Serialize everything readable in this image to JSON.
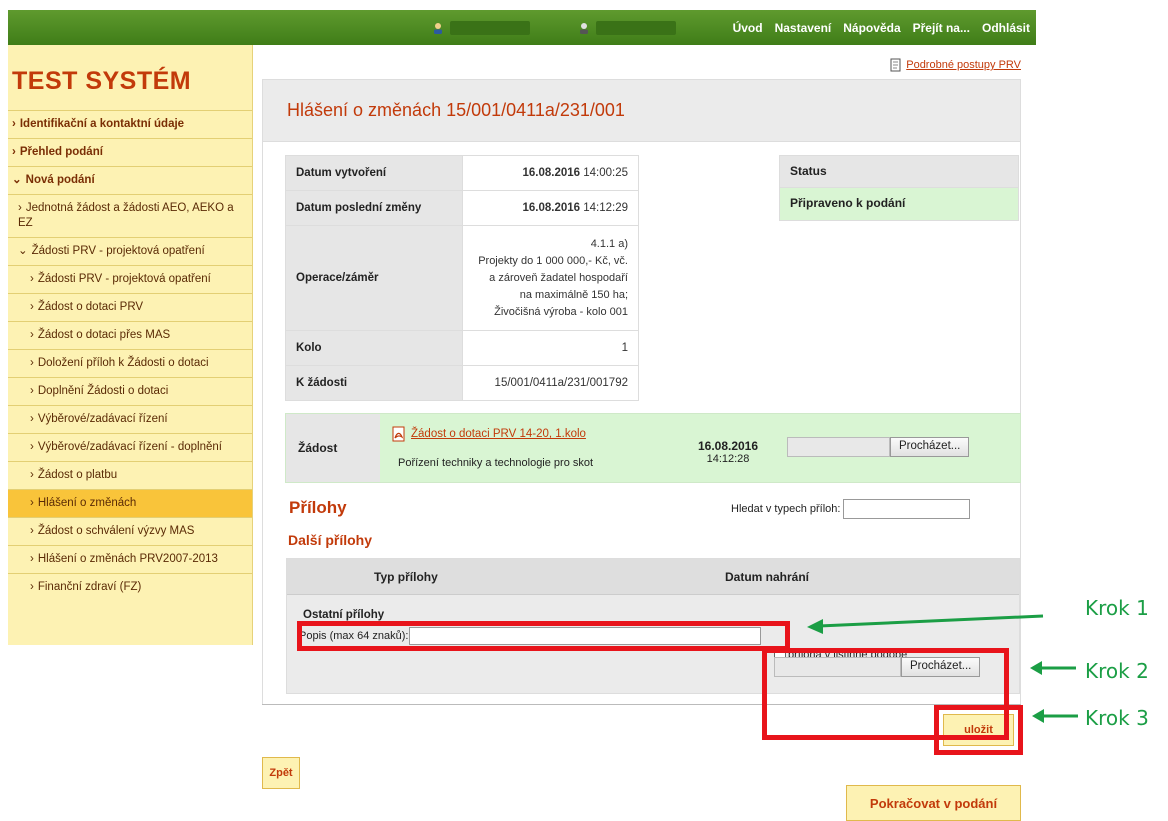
{
  "topbar": {
    "nav": [
      "Úvod",
      "Nastavení",
      "Nápověda",
      "Přejít na...",
      "Odhlásit"
    ]
  },
  "sidebar": {
    "logo": "TEST SYSTÉM",
    "items": [
      {
        "label": "Identifikační a kontaktní údaje",
        "level": 0,
        "chev": "›"
      },
      {
        "label": "Přehled podání",
        "level": 0,
        "chev": "›"
      },
      {
        "label": "Nová podání",
        "level": 0,
        "chev": "⌄"
      },
      {
        "label": "Jednotná žádost a žádosti AEO, AEKO a EZ",
        "level": 1,
        "chev": "›"
      },
      {
        "label": "Žádosti PRV - projektová opatření",
        "level": 1,
        "chev": "⌄"
      },
      {
        "label": "Žádosti PRV - projektová opatření",
        "level": 2,
        "chev": "›"
      },
      {
        "label": "Žádost o dotaci PRV",
        "level": 2,
        "chev": "›"
      },
      {
        "label": "Žádost o dotaci přes MAS",
        "level": 2,
        "chev": "›"
      },
      {
        "label": "Doložení příloh k Žádosti o dotaci",
        "level": 2,
        "chev": "›"
      },
      {
        "label": "Doplnění Žádosti o dotaci",
        "level": 2,
        "chev": "›"
      },
      {
        "label": "Výběrové/zadávací řízení",
        "level": 2,
        "chev": "›"
      },
      {
        "label": "Výběrové/zadávací řízení - doplnění",
        "level": 2,
        "chev": "›"
      },
      {
        "label": "Žádost o platbu",
        "level": 2,
        "chev": "›"
      },
      {
        "label": "Hlášení o změnách",
        "level": 2,
        "chev": "›",
        "active": true
      },
      {
        "label": "Žádost o schválení výzvy MAS",
        "level": 2,
        "chev": "›"
      },
      {
        "label": "Hlášení o změnách PRV2007-2013",
        "level": 2,
        "chev": "›"
      },
      {
        "label": "Finanční zdraví (FZ)",
        "level": 2,
        "chev": "›"
      }
    ]
  },
  "main": {
    "help_link": "Podrobné postupy PRV",
    "title": "Hlášení o změnách 15/001/0411a/231/001",
    "info": {
      "created_label": "Datum vytvoření",
      "created_date": "16.08.2016",
      "created_time": "14:00:25",
      "changed_label": "Datum poslední změny",
      "changed_date": "16.08.2016",
      "changed_time": "14:12:29",
      "operation_label": "Operace/záměr",
      "operation_value": "4.1.1 a)\nProjekty do 1 000 000,- Kč, vč.\na zároveň žadatel hospodaří\nna maximálně 150 ha;\nŽivočišná výroba - kolo 001",
      "round_label": "Kolo",
      "round_value": "1",
      "request_label": "K žádosti",
      "request_value": "15/001/0411a/231/001792"
    },
    "status": {
      "label": "Status",
      "value": "Připraveno k podání"
    },
    "zadost": {
      "label": "Žádost",
      "doc_link": "Žádost o dotaci PRV 14-20, 1.kolo",
      "description": "Pořízení techniky a technologie pro skot",
      "date": "16.08.2016",
      "time": "14:12:28",
      "browse_label": "Procházet..."
    },
    "prilohy_title": "Přílohy",
    "search_label": "Hledat v typech příloh:",
    "dalsi_title": "Další přílohy",
    "table": {
      "col_type": "Typ přílohy",
      "col_date": "Datum nahrání",
      "row_title": "Ostatní přílohy",
      "popis_label": "Popis (max 64 znaků):",
      "paper_label": "příloha v listinné podobě",
      "browse_label": "Procházet..."
    },
    "save_label": "uložit",
    "back_label": "Zpět",
    "continue_label": "Pokračovat v podání"
  },
  "annotations": {
    "step1": "Krok 1",
    "step2": "Krok 2",
    "step3": "Krok 3",
    "color_red": "#e8141b",
    "color_green": "#1b9e45"
  }
}
